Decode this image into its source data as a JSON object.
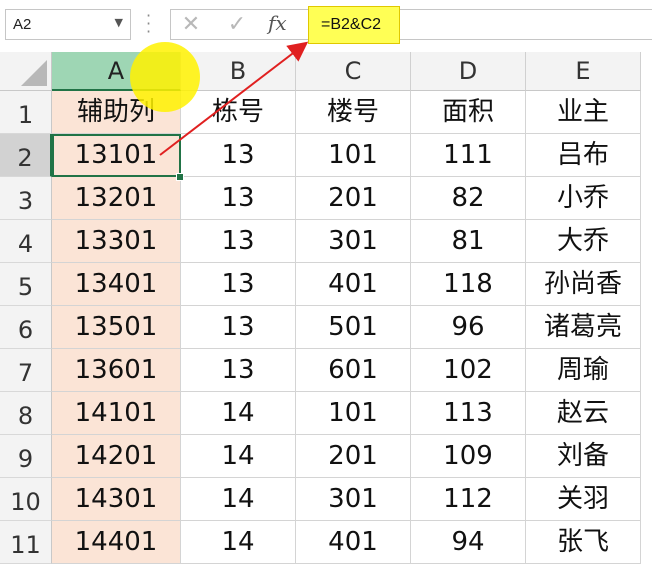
{
  "name_box": {
    "value": "A2"
  },
  "formula_bar": {
    "cancel_symbol": "✕",
    "enter_symbol": "✓",
    "fx_label": "fx",
    "formula": "=B2&C2"
  },
  "columns": [
    "A",
    "B",
    "C",
    "D",
    "E"
  ],
  "selected_column": "A",
  "selected_row": "2",
  "rows": [
    {
      "num": "1",
      "cells": [
        "辅助列",
        "栋号",
        "楼号",
        "面积",
        "业主"
      ]
    },
    {
      "num": "2",
      "cells": [
        "13101",
        "13",
        "101",
        "111",
        "吕布"
      ]
    },
    {
      "num": "3",
      "cells": [
        "13201",
        "13",
        "201",
        "82",
        "小乔"
      ]
    },
    {
      "num": "4",
      "cells": [
        "13301",
        "13",
        "301",
        "81",
        "大乔"
      ]
    },
    {
      "num": "5",
      "cells": [
        "13401",
        "13",
        "401",
        "118",
        "孙尚香"
      ]
    },
    {
      "num": "6",
      "cells": [
        "13501",
        "13",
        "501",
        "96",
        "诸葛亮"
      ]
    },
    {
      "num": "7",
      "cells": [
        "13601",
        "13",
        "601",
        "102",
        "周瑜"
      ]
    },
    {
      "num": "8",
      "cells": [
        "14101",
        "14",
        "101",
        "113",
        "赵云"
      ]
    },
    {
      "num": "9",
      "cells": [
        "14201",
        "14",
        "201",
        "109",
        "刘备"
      ]
    },
    {
      "num": "10",
      "cells": [
        "14301",
        "14",
        "301",
        "112",
        "关羽"
      ]
    },
    {
      "num": "11",
      "cells": [
        "14401",
        "14",
        "401",
        "94",
        "张飞"
      ]
    }
  ],
  "colors": {
    "helper_fill": "#fbe4d6",
    "selection_green": "#217346",
    "highlight_yellow": "#ffff55",
    "arrow_red": "#e02020"
  }
}
